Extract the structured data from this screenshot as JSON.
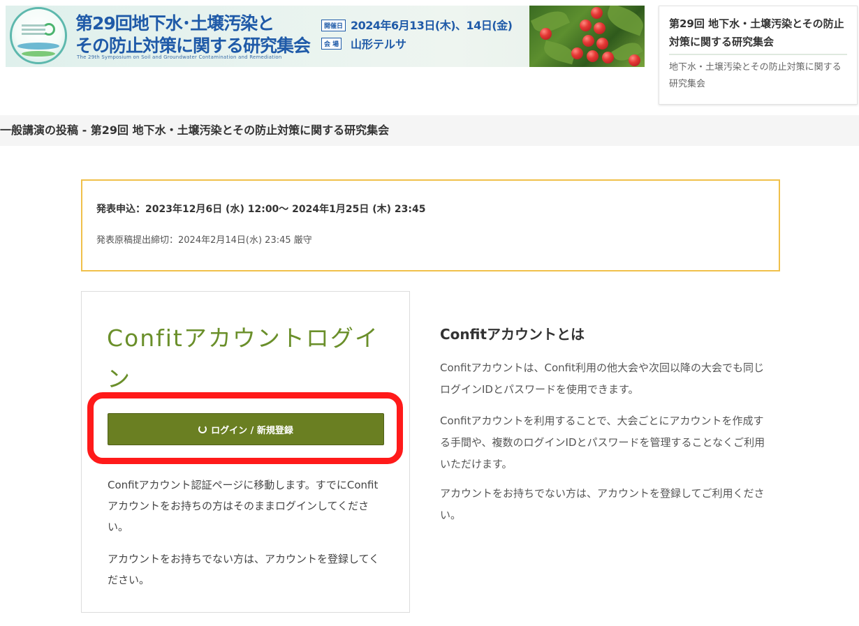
{
  "banner": {
    "title_line1": "第29回地下水･土壌汚染と",
    "title_line2": "その防止対策に関する研究集会",
    "subtitle_en": "The 29th Symposium on Soil and Groundwater Contamination and Remediation",
    "date_tag": "開催日",
    "date": "2024年6月13日(木)、14日(金)",
    "venue_tag": "会 場",
    "venue": "山形テルサ"
  },
  "side_card": {
    "title": "第29回 地下水・土壌汚染とその防止対策に関する研究集会",
    "description": "地下水・土壌汚染とその防止対策に関する研究集会"
  },
  "page_heading": "一般講演の投稿 - 第29回 地下水・土壌汚染とその防止対策に関する研究集会",
  "notice": {
    "line1": "発表申込：2023年12月6日 (水) 12:00～ 2024年1月25日 (木) 23:45",
    "line2": "発表原稿提出締切：2024年2月14日(水) 23:45 厳守"
  },
  "login": {
    "title": "Confitアカウントログイン",
    "button_label": "ログイン / 新規登録",
    "desc1": "Confitアカウント認証ページに移動します。すでにConfitアカウントをお持ちの方はそのままログインしてください。",
    "desc2": "アカウントをお持ちでない方は、アカウントを登録してください。"
  },
  "about": {
    "title": "Confitアカウントとは",
    "p1": "Confitアカウントは、Confit利用の他大会や次回以降の大会でも同じログインIDとパスワードを使用できます。",
    "p2": "Confitアカウントを利用することで、大会ごとにアカウントを作成する手間や、複数のログインIDとパスワードを管理することなくご利用いただけます。",
    "p3": "アカウントをお持ちでない方は、アカウントを登録してご利用ください。"
  },
  "colors": {
    "accent_green": "#6a7f22",
    "title_green": "#6a8f2a",
    "notice_border": "#f0c04a",
    "highlight_red": "#ff1a1a",
    "banner_blue": "#1f5aa8"
  }
}
